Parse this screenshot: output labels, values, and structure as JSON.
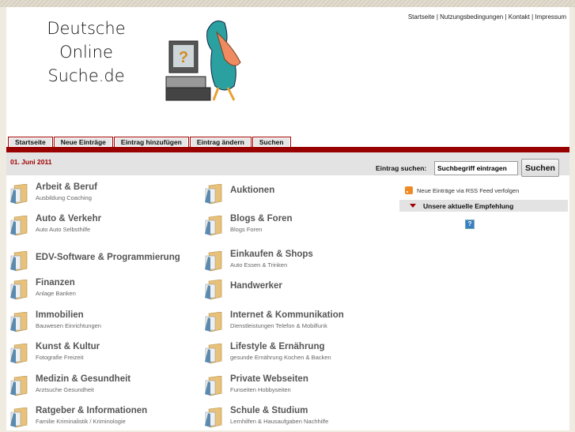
{
  "logo": {
    "line1": "Deutsche",
    "line2": "Online Suche.de"
  },
  "toplinks": [
    "Startseite",
    "Nutzungsbedingungen",
    "Kontakt",
    "Impressum"
  ],
  "tabs": [
    "Startseite",
    "Neue Einträge",
    "Eintrag hinzufügen",
    "Eintrag ändern",
    "Suchen"
  ],
  "date": "01. Juni 2011",
  "search": {
    "label": "Eintrag suchen:",
    "value": "Suchbegriff eintragen",
    "button": "Suchen"
  },
  "categories_left": [
    {
      "title": "Arbeit & Beruf",
      "sub": "Ausbildung Coaching"
    },
    {
      "title": "Auto & Verkehr",
      "sub": "Auto Auto Selbsthilfe"
    },
    {
      "title": "EDV-Software & Programmierung",
      "sub": ""
    },
    {
      "title": "Finanzen",
      "sub": "Anlage Banken"
    },
    {
      "title": "Immobilien",
      "sub": "Bauwesen Einrichtungen"
    },
    {
      "title": "Kunst & Kultur",
      "sub": "Fotografie Freizeit"
    },
    {
      "title": "Medizin & Gesundheit",
      "sub": "Arztsuche Gesundheit"
    },
    {
      "title": "Ratgeber & Informationen",
      "sub": "Familie Kriminalistik / Kriminologie"
    }
  ],
  "categories_right": [
    {
      "title": "Auktionen",
      "sub": ""
    },
    {
      "title": "Blogs & Foren",
      "sub": "Blogs Foren"
    },
    {
      "title": "Einkaufen & Shops",
      "sub": "Auto Essen & Trinken"
    },
    {
      "title": "Handwerker",
      "sub": ""
    },
    {
      "title": "Internet & Kommunikation",
      "sub": "Dienstleistungen Telefon & Mobilfunk"
    },
    {
      "title": "Lifestyle & Ernährung",
      "sub": "gesunde Ernährung Kochen & Backen"
    },
    {
      "title": "Private Webseiten",
      "sub": "Funseiten Hobbyseiten"
    },
    {
      "title": "Schule & Studium",
      "sub": "Lernhilfen & Hausaufgaben Nachhilfe"
    }
  ],
  "sidebar": {
    "rss": "Neue Einträge via RSS Feed verfolgen",
    "recommend": "Unsere aktuelle Empfehlung",
    "placeholder_icon": "?"
  }
}
